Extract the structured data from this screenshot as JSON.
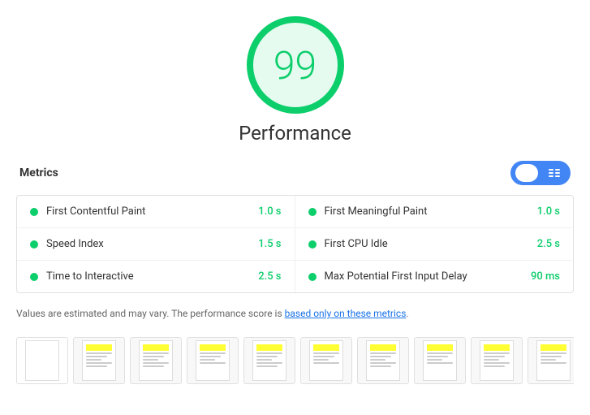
{
  "score": {
    "value": "99",
    "label": "Performance"
  },
  "metrics_header": {
    "title": "Metrics",
    "toggle": {
      "list_view_label": "list view",
      "grid_view_label": "grid view"
    }
  },
  "metrics": [
    {
      "name": "First Contentful Paint",
      "value": "1.0 s",
      "color": "green"
    },
    {
      "name": "First Meaningful Paint",
      "value": "1.0 s",
      "color": "green"
    },
    {
      "name": "Speed Index",
      "value": "1.5 s",
      "color": "green"
    },
    {
      "name": "First CPU Idle",
      "value": "2.5 s",
      "color": "green"
    },
    {
      "name": "Time to Interactive",
      "value": "2.5 s",
      "color": "green"
    },
    {
      "name": "Max Potential First Input Delay",
      "value": "90 ms",
      "color": "green"
    }
  ],
  "note": {
    "text_before": "Values are estimated and may vary. The performance score is ",
    "link_text": "based only on these metrics",
    "text_after": "."
  },
  "filmstrip": {
    "count": 10
  }
}
